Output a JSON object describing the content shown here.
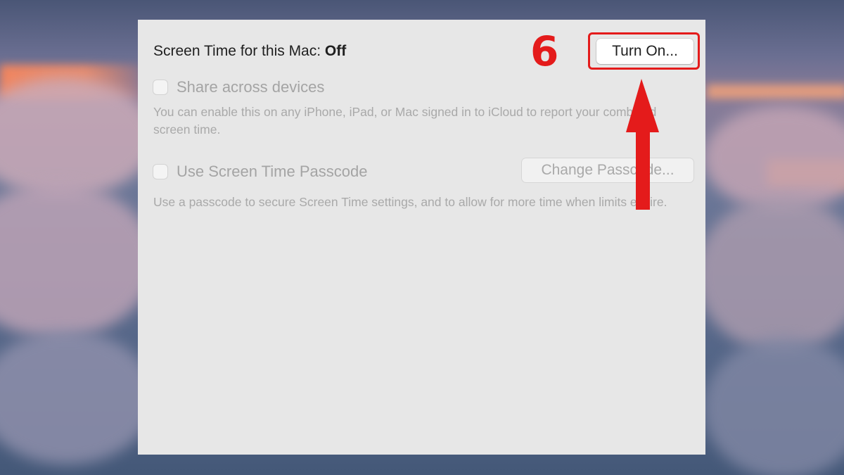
{
  "screen_time": {
    "title_label": "Screen Time for this Mac:",
    "status": "Off",
    "turn_on_label": "Turn On..."
  },
  "annotation": {
    "step_number": "6",
    "color": "#e41b1b"
  },
  "share_across_devices": {
    "label": "Share across devices",
    "checked": false,
    "description": "You can enable this on any iPhone, iPad, or Mac signed in to iCloud to report your combined screen time."
  },
  "passcode": {
    "label": "Use Screen Time Passcode",
    "checked": false,
    "change_label": "Change Passcode...",
    "description": "Use a passcode to secure Screen Time settings, and to allow for more time when limits expire."
  }
}
